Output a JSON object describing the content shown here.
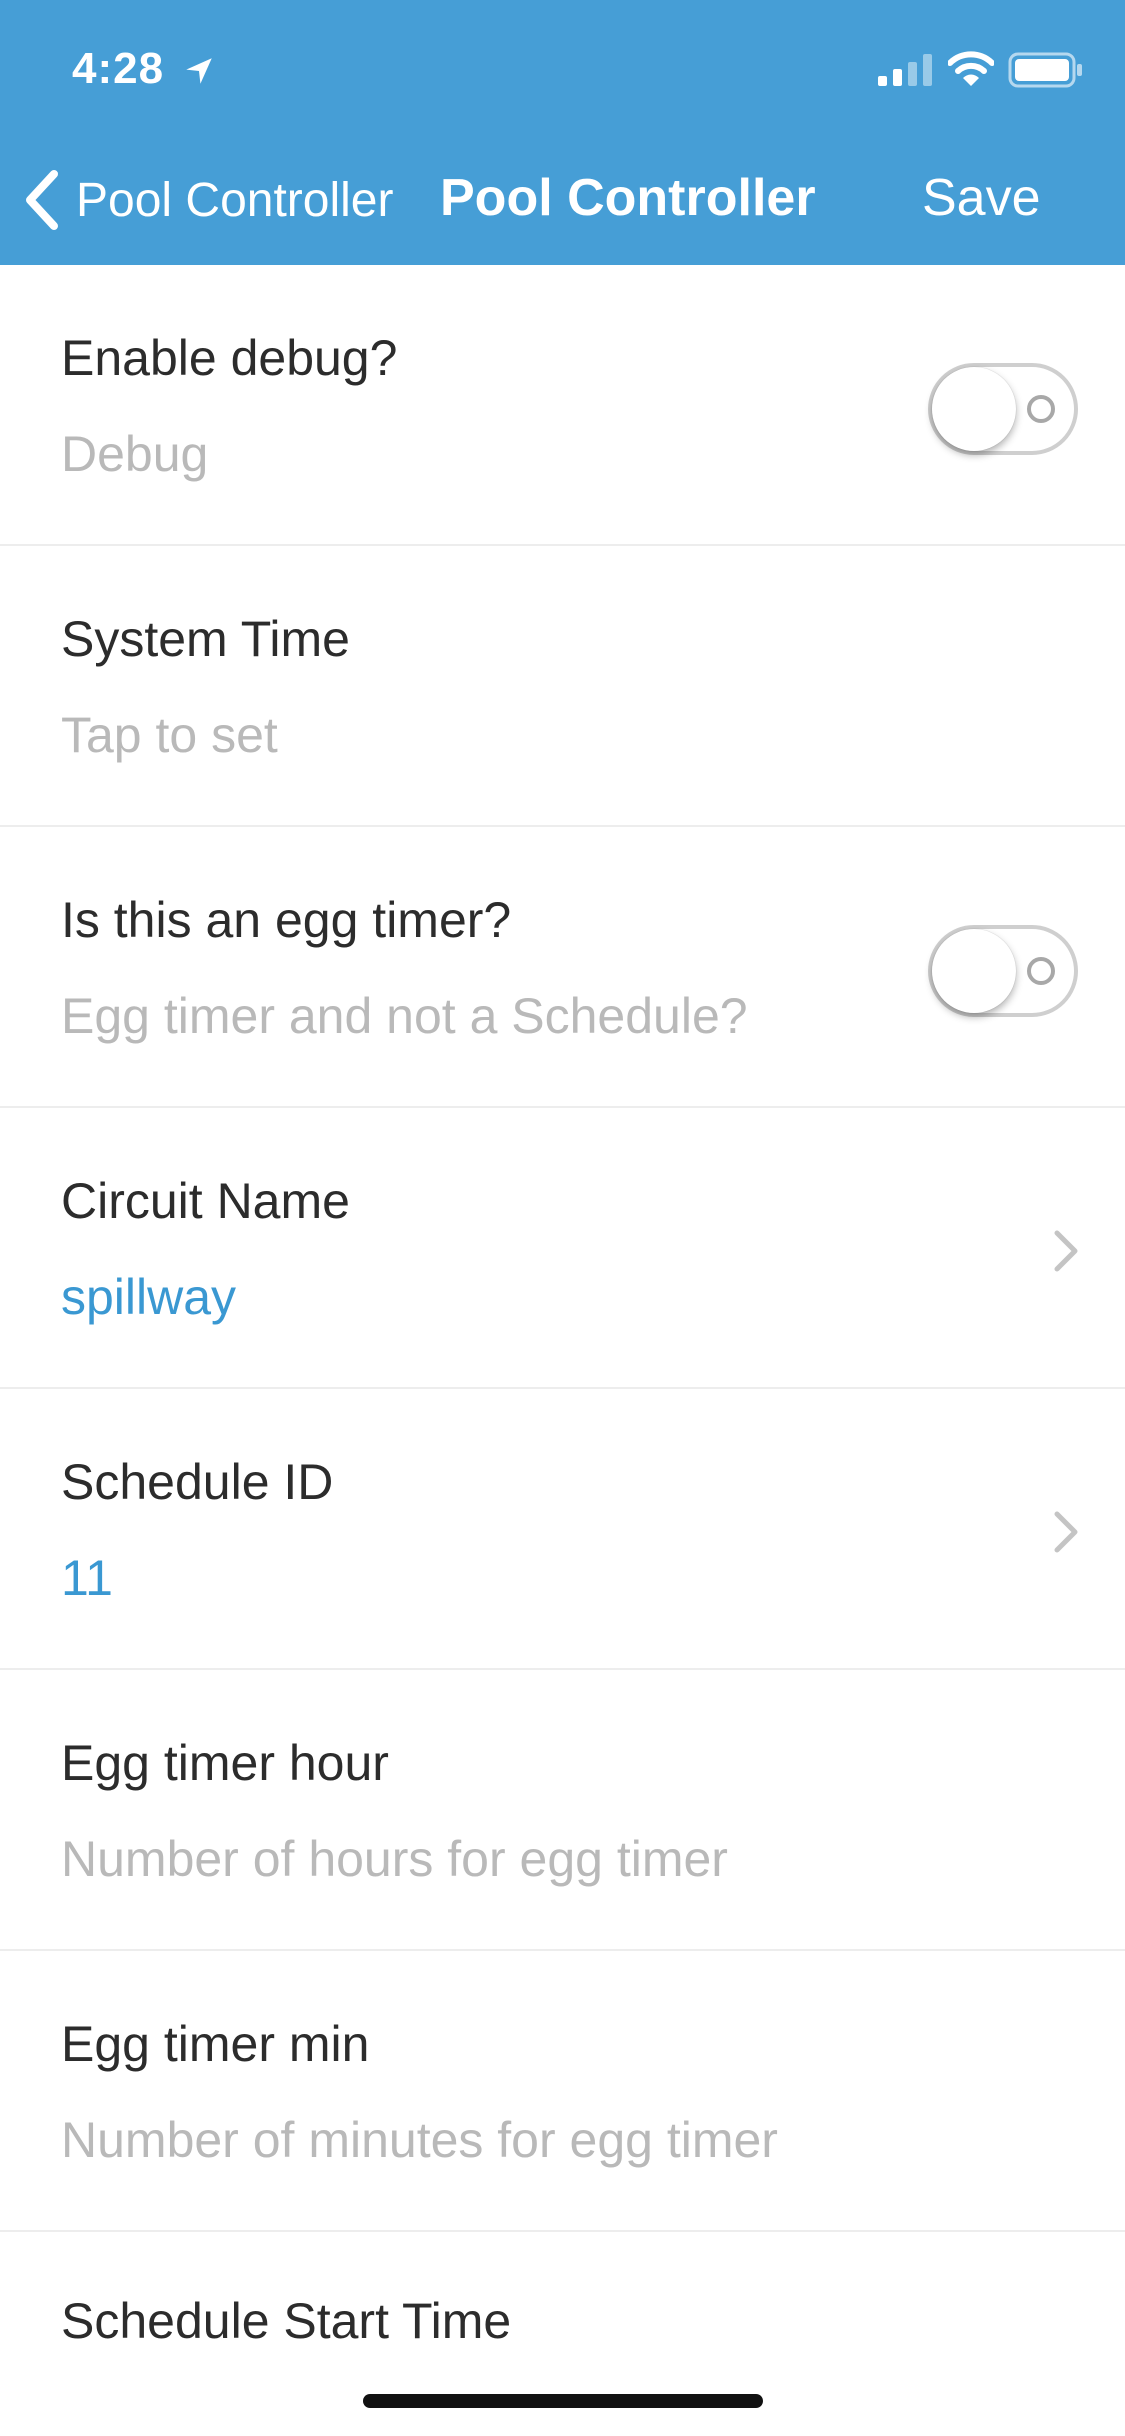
{
  "status_bar": {
    "time": "4:28"
  },
  "nav": {
    "back_label": "Pool Controller",
    "title": "Pool Controller",
    "save_label": "Save"
  },
  "rows": [
    {
      "title": "Enable debug?",
      "subtitle": "Debug",
      "control": "toggle",
      "enabled": false
    },
    {
      "title": "System Time",
      "subtitle": "Tap to set"
    },
    {
      "title": "Is this an egg timer?",
      "subtitle": "Egg timer and not a Schedule?",
      "control": "toggle",
      "enabled": false
    },
    {
      "title": "Circuit Name",
      "value": "spillway",
      "control": "chevron"
    },
    {
      "title": "Schedule ID",
      "value": "11",
      "control": "chevron"
    },
    {
      "title": "Egg timer hour",
      "subtitle": "Number of hours for egg timer"
    },
    {
      "title": "Egg timer min",
      "subtitle": "Number of minutes for egg timer"
    },
    {
      "title": "Schedule Start Time"
    }
  ],
  "icons": {
    "back": "chevron-left-icon",
    "disclosure": "chevron-right-icon",
    "location": "location-arrow-icon",
    "signal": "cellular-signal-icon",
    "wifi": "wifi-icon",
    "battery": "battery-icon"
  },
  "colors": {
    "header_bg": "#469ed6",
    "value_text": "#3a98d2",
    "placeholder_text": "#b9b9b9",
    "title_text": "#2c2c2c"
  }
}
